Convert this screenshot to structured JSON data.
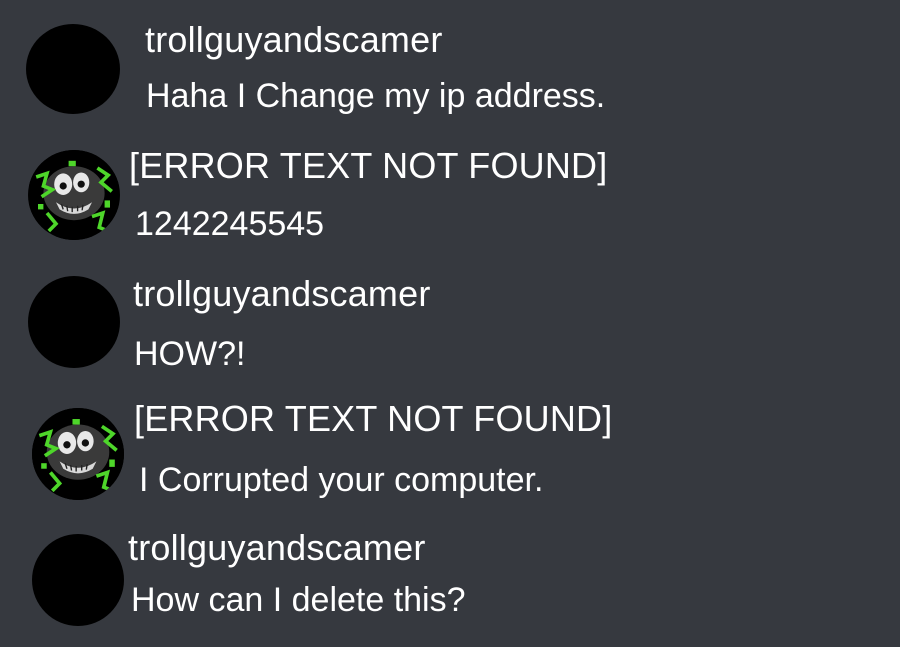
{
  "messages": [
    {
      "author": "trollguyandscamer",
      "avatar_icon": "black-circle-avatar",
      "text": "Haha I Change my ip address."
    },
    {
      "author": "[ERROR TEXT NOT FOUND]",
      "avatar_icon": "glitched-creature-avatar",
      "text": "1242245545"
    },
    {
      "author": "trollguyandscamer",
      "avatar_icon": "black-circle-avatar",
      "text": "HOW?!"
    },
    {
      "author": "[ERROR TEXT NOT FOUND]",
      "avatar_icon": "glitched-creature-avatar",
      "text": "I Corrupted your computer."
    },
    {
      "author": "trollguyandscamer",
      "avatar_icon": "black-circle-avatar",
      "text": "How can I delete this?"
    }
  ],
  "colors": {
    "background": "#36393f",
    "text": "#ffffff",
    "avatar_black": "#000000",
    "glitch_green": "#4ed62a"
  }
}
